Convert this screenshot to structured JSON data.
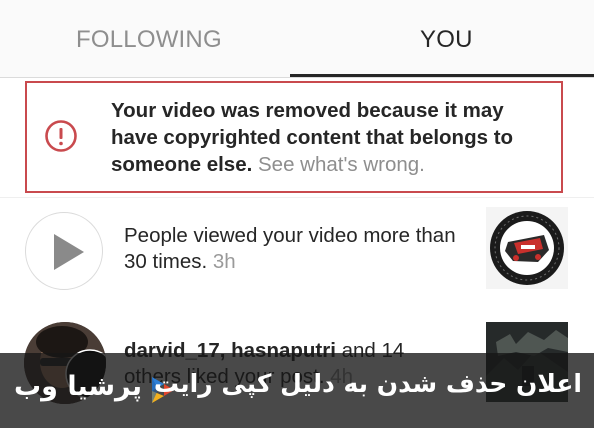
{
  "tabs": {
    "following_label": "FOLLOWING",
    "you_label": "YOU",
    "active": "YOU"
  },
  "warning": {
    "icon": "exclamation-circle-icon",
    "message": "Your video was removed because it may have copyrighted content that belongs to someone else.",
    "link_label": "See what's wrong.",
    "border_color": "#c94a4e"
  },
  "notifications": [
    {
      "icon": "play-icon",
      "text": "People viewed your video more than 30 times.",
      "time": "3h",
      "thumbnail": "april-8th-2017-worldwide-badge"
    },
    {
      "avatar": "user-avatar",
      "usernames": "darvid_17, hasnaputri",
      "text": "and 14 others liked your post.",
      "time": "4h",
      "thumbnail": "dark-post-thumbnail"
    }
  ],
  "caption": {
    "text": "اعلان حذف شدن به دلیل کپی رایت",
    "brand_name": "پرشیا وب",
    "brand_logo": "persia-web-logo"
  },
  "colors": {
    "text": "#262626",
    "muted": "#8e8e8e",
    "divider": "#dbdbdb"
  }
}
